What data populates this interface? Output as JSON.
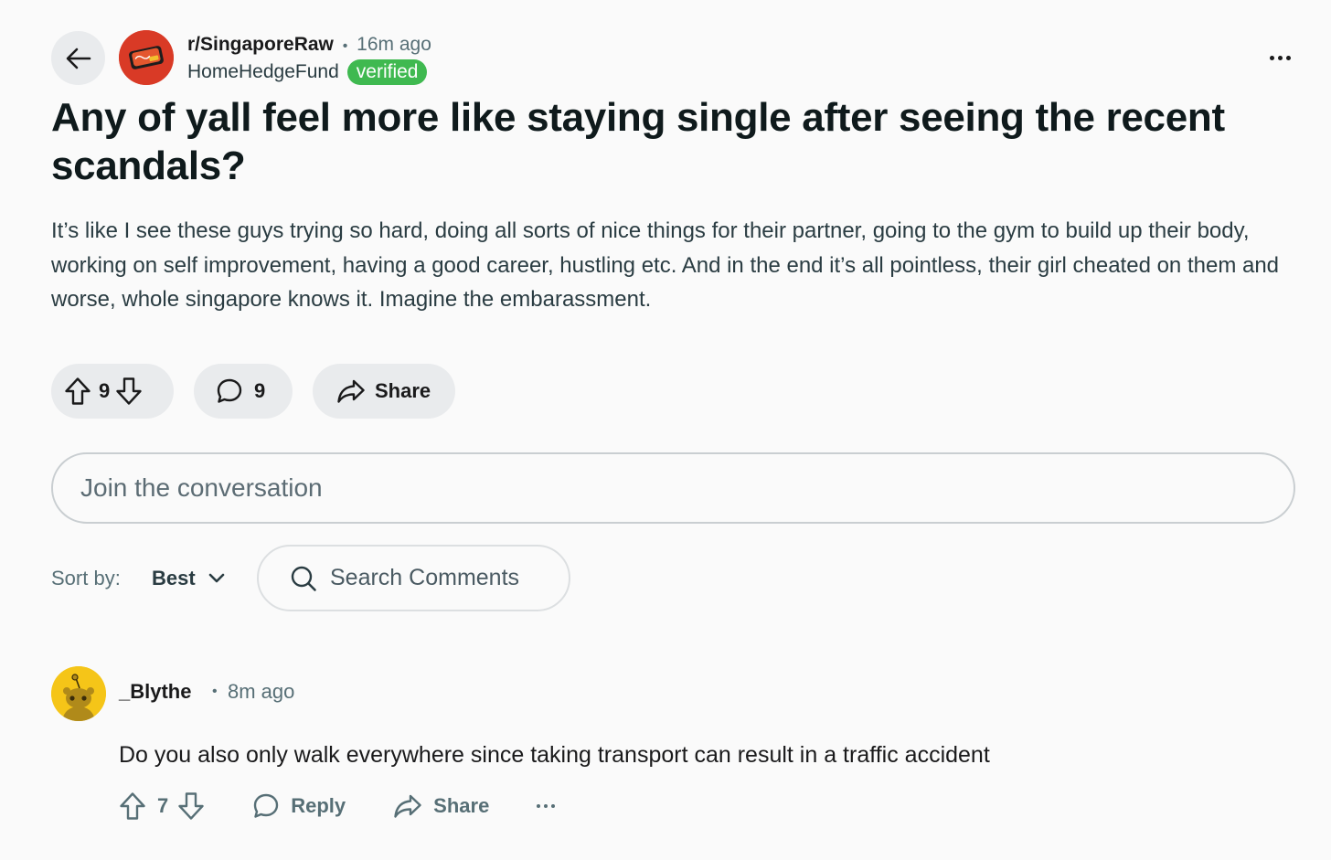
{
  "post": {
    "subreddit": "r/SingaporeRaw",
    "separator": "•",
    "time_ago": "16m ago",
    "author": "HomeHedgeFund",
    "flair": "verified",
    "title": "Any of yall feel more like staying single after seeing the recent scandals?",
    "body": "It’s like I see these guys trying so hard, doing all sorts of nice things for their partner, going to the gym to build up their body, working on self improvement, having a good career, hustling etc. And in the end it’s all pointless, their girl cheated on them and worse, whole singapore knows it. Imagine the embarassment.",
    "vote_count": "9",
    "comment_count": "9",
    "share_label": "Share"
  },
  "composer": {
    "placeholder": "Join the conversation"
  },
  "sort": {
    "label": "Sort by:",
    "selected": "Best"
  },
  "search": {
    "placeholder": "Search Comments"
  },
  "comment": {
    "author": "_Blythe",
    "separator": "•",
    "time_ago": "8m ago",
    "body": "Do you also only walk everywhere since taking transport can result in a traffic accident",
    "vote_count": "7",
    "reply_label": "Reply",
    "share_label": "Share"
  },
  "colors": {
    "background": "#fafafa",
    "pill": "#e9ebed",
    "verified_badge": "#3fb950",
    "subreddit_avatar": "#d93a26",
    "user_avatar": "#f5c518"
  },
  "icons": [
    "back-arrow-icon",
    "subreddit-avatar",
    "more-options-icon",
    "upvote-icon",
    "downvote-icon",
    "comment-icon",
    "share-icon",
    "chevron-down-icon",
    "search-icon",
    "user-avatar",
    "reply-icon"
  ]
}
